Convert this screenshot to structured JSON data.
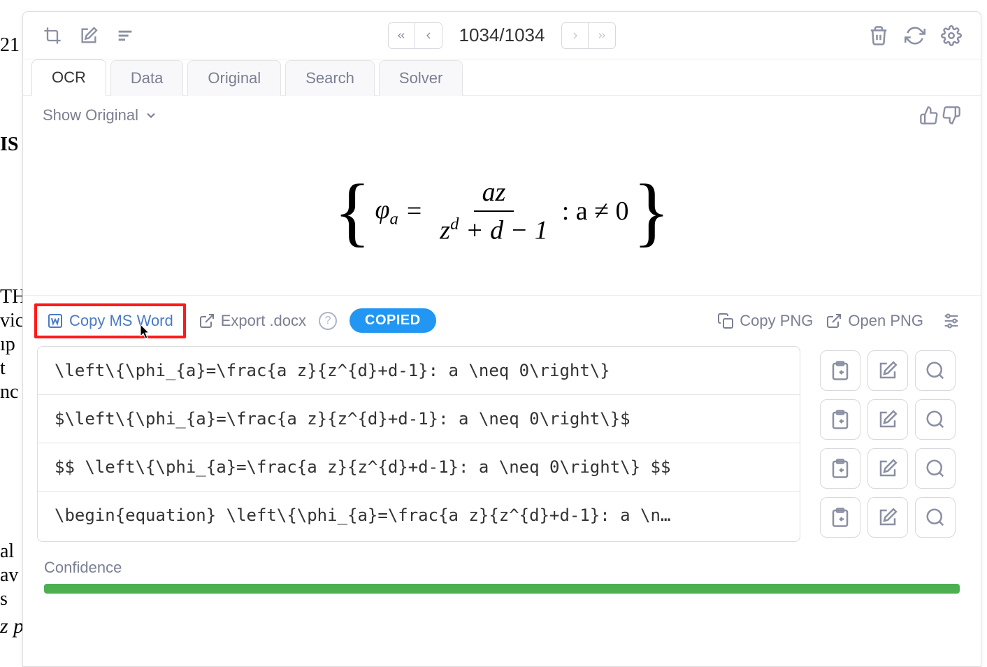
{
  "page_counter": "1034/1034",
  "tabs": [
    "OCR",
    "Data",
    "Original",
    "Search",
    "Solver"
  ],
  "active_tab": "OCR",
  "show_original_label": "Show Original",
  "actions": {
    "copy_word": "Copy MS Word",
    "export_docx": "Export .docx",
    "copied_badge": "COPIED",
    "copy_png": "Copy PNG",
    "open_png": "Open PNG"
  },
  "equation": {
    "phi": "φ",
    "sub_a": "a",
    "eq": "=",
    "num": "az",
    "den_z": "z",
    "den_d": "d",
    "den_rest": " + d − 1",
    "colon": " : a ≠ 0"
  },
  "code_rows": [
    "\\left\\{\\phi_{a}=\\frac{a z}{z^{d}+d-1}: a \\neq 0\\right\\}",
    "$\\left\\{\\phi_{a}=\\frac{a z}{z^{d}+d-1}: a \\neq 0\\right\\}$",
    "$$ \\left\\{\\phi_{a}=\\frac{a z}{z^{d}+d-1}: a \\neq 0\\right\\} $$",
    "\\begin{equation} \\left\\{\\phi_{a}=\\frac{a z}{z^{d}+d-1}: a \\n…"
  ],
  "confidence_label": "Confidence",
  "bg": {
    "l1": "21",
    "l2": "IS",
    "l3": "TH",
    "l4": "vic",
    "l5": "ıp",
    "l6": "t",
    "l7": "nc",
    "l8": "al",
    "l9": "av",
    "l10": "s",
    "l11": "z points for a fixed degree d and a fixed dynamical portrait (m, n) are roots of a"
  }
}
